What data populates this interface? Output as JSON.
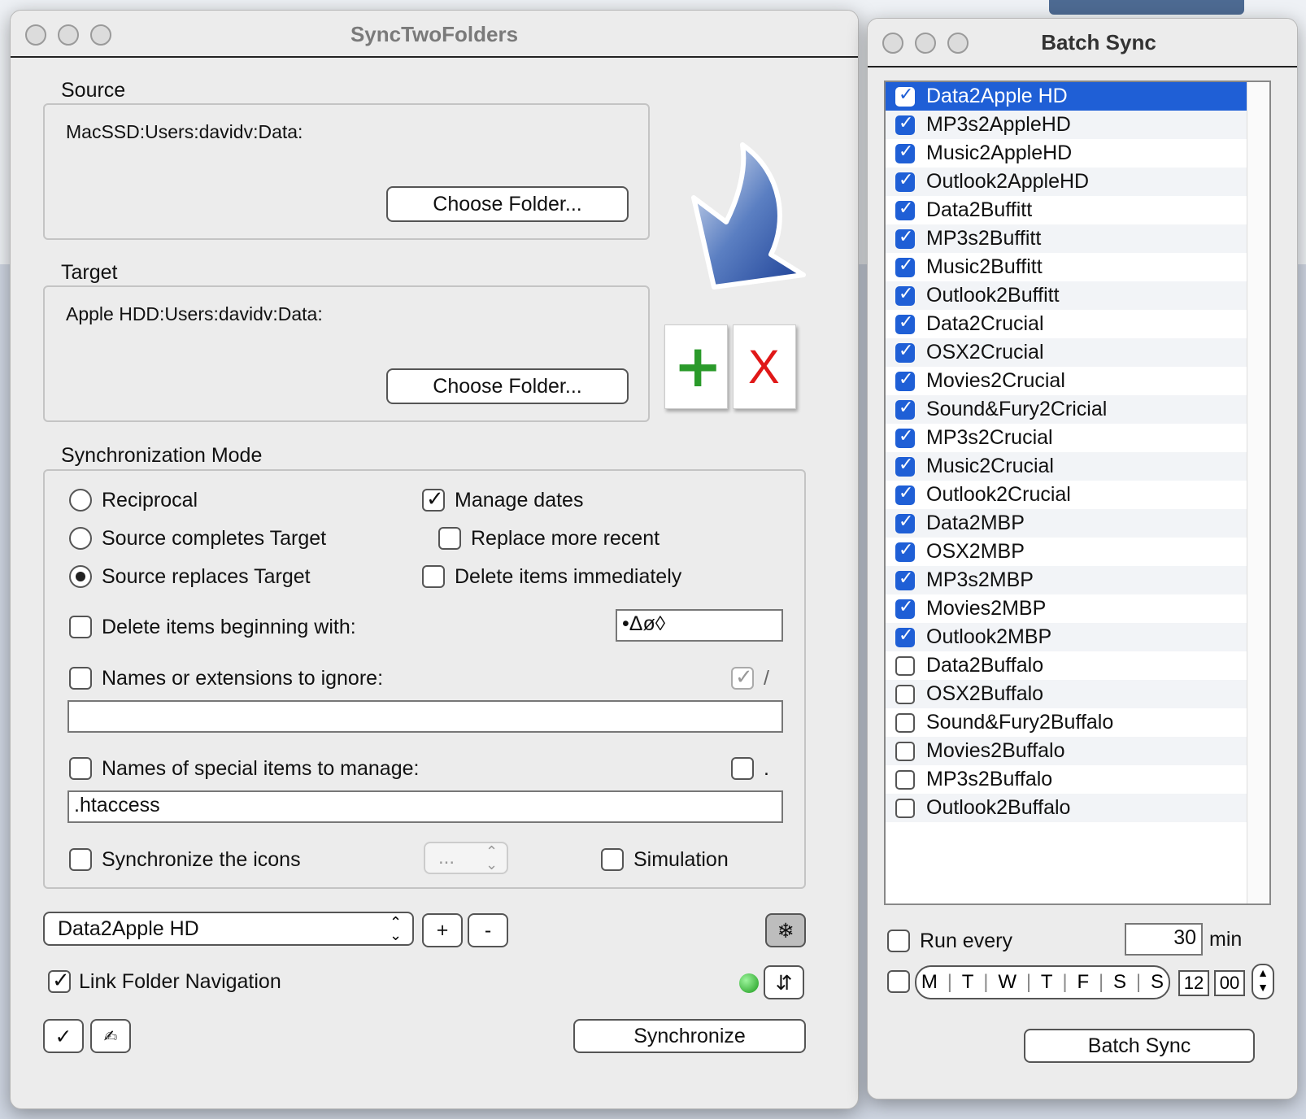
{
  "main": {
    "title": "SyncTwoFolders",
    "source": {
      "heading": "Source",
      "path": "MacSSD:Users:davidv:Data:",
      "button": "Choose Folder..."
    },
    "target": {
      "heading": "Target",
      "path": "Apple HDD:Users:davidv:Data:",
      "button": "Choose Folder..."
    },
    "mode": {
      "heading": "Synchronization Mode",
      "reciprocal": "Reciprocal",
      "completes": "Source completes Target",
      "replaces": "Source replaces Target",
      "manage_dates": "Manage dates",
      "replace_recent": "Replace more recent",
      "delete_immediately": "Delete items immediately",
      "delete_beginning": "Delete items beginning with:",
      "delete_beginning_value": "•Δø◊",
      "ignore_label": "Names or extensions to ignore:",
      "ignore_slash": "/",
      "ignore_value": "",
      "special_label": "Names of special items to manage:",
      "special_dot": ".",
      "special_value": ".htaccess",
      "icons_label": "Synchronize the icons",
      "icons_popup": "...",
      "simulation": "Simulation"
    },
    "preset_popup": "Data2Apple HD",
    "add_btn": "+",
    "remove_btn": "-",
    "gear_glyph": "❄",
    "link_nav": "Link Folder Navigation",
    "swap_glyph": "⇵",
    "check_glyph": "✓",
    "edit_glyph": "✍",
    "sync_btn": "Synchronize",
    "plus_glyph": "+",
    "x_glyph": "X"
  },
  "batch": {
    "title": "Batch Sync",
    "items": [
      {
        "label": "Data2Apple HD",
        "checked": true,
        "selected": true
      },
      {
        "label": "MP3s2AppleHD",
        "checked": true
      },
      {
        "label": "Music2AppleHD",
        "checked": true
      },
      {
        "label": "Outlook2AppleHD",
        "checked": true
      },
      {
        "label": "Data2Buffitt",
        "checked": true
      },
      {
        "label": "MP3s2Buffitt",
        "checked": true
      },
      {
        "label": "Music2Buffitt",
        "checked": true
      },
      {
        "label": "Outlook2Buffitt",
        "checked": true
      },
      {
        "label": "Data2Crucial",
        "checked": true
      },
      {
        "label": "OSX2Crucial",
        "checked": true
      },
      {
        "label": "Movies2Crucial",
        "checked": true
      },
      {
        "label": "Sound&Fury2Cricial",
        "checked": true
      },
      {
        "label": "MP3s2Crucial",
        "checked": true
      },
      {
        "label": "Music2Crucial",
        "checked": true
      },
      {
        "label": "Outlook2Crucial",
        "checked": true
      },
      {
        "label": "Data2MBP",
        "checked": true
      },
      {
        "label": "OSX2MBP",
        "checked": true
      },
      {
        "label": "MP3s2MBP",
        "checked": true
      },
      {
        "label": "Movies2MBP",
        "checked": true
      },
      {
        "label": "Outlook2MBP",
        "checked": true
      },
      {
        "label": "Data2Buffalo",
        "checked": false
      },
      {
        "label": "OSX2Buffalo",
        "checked": false
      },
      {
        "label": "Sound&Fury2Buffalo",
        "checked": false
      },
      {
        "label": "Movies2Buffalo",
        "checked": false
      },
      {
        "label": "MP3s2Buffalo",
        "checked": false
      },
      {
        "label": "Outlook2Buffalo",
        "checked": false
      }
    ],
    "run_every": "Run every",
    "interval": "30",
    "unit": "min",
    "days": [
      "M",
      "T",
      "W",
      "T",
      "F",
      "S",
      "S"
    ],
    "hour": "12",
    "minute": "00",
    "button": "Batch Sync"
  }
}
